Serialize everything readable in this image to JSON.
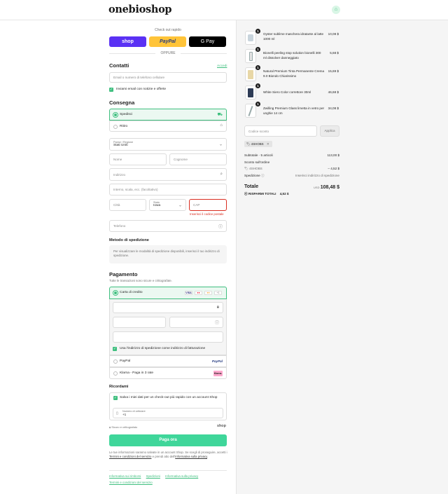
{
  "header": {
    "logo": "onebioshop",
    "cart_icon": "shopping-bag-icon"
  },
  "express": {
    "title": "Check out rapido",
    "shop_label": "shop",
    "paypal_label": "PayPal",
    "gpay_label": "G Pay",
    "or_label": "OPPURE",
    "colors": {
      "shop": "#5a31f4",
      "paypal": "#ffc439",
      "gpay": "#000000"
    }
  },
  "contact": {
    "title": "Contatti",
    "login_link": "Accedi",
    "email_placeholder": "Email o numero di telefono cellulare",
    "newsletter_label": "Inviami email con notizie e offerte"
  },
  "delivery": {
    "title": "Consegna",
    "options": [
      {
        "label": "Spedisci",
        "selected": true,
        "icon": "truck-icon"
      },
      {
        "label": "Ritiro",
        "selected": false,
        "icon": "store-icon"
      }
    ],
    "country_label": "Paese / Regione",
    "country_value": "Stati Uniti",
    "first_name_placeholder": "Nome",
    "last_name_placeholder": "Cognome",
    "address_placeholder": "Indirizzo",
    "apt_placeholder": "Interno, scala, ecc. (facoltativo)",
    "city_placeholder": "Città",
    "state_label": "Stato",
    "state_value": "Iowa",
    "zip_placeholder": "CAP",
    "zip_error": "Inserisci il codice postale",
    "phone_placeholder": "Telefono"
  },
  "shipping_method": {
    "title": "Metodo di spedizione",
    "info": "Per visualizzare le modalità di spedizione disponibili, inserisci il tuo indirizzo di spedizione."
  },
  "payment": {
    "title": "Pagamento",
    "subtitle": "Tutte le transazioni sono sicure e crittografate.",
    "card_label": "Carta di credito",
    "card_brands": [
      "VISA",
      "Maestro",
      "Mastercard",
      "+1"
    ],
    "billing_same_label": "Usa l'indirizzo di spedizione come indirizzo di fatturazione",
    "paypal_label": "PayPal",
    "paypal_logo": "PayPal",
    "klarna_label": "Klarna - Paga in 3 rate",
    "klarna_logo": "Klarna."
  },
  "remember": {
    "title": "Ricordami",
    "save_label": "Salva i miei dati per un check-out più rapido con un account Shop",
    "mobile_label": "Numero di cellulare",
    "mobile_prefix": "+1",
    "secure_label": "Sicuro e crittografato",
    "shop_label": "shop"
  },
  "pay_button": "Paga ora",
  "legal_text_1": "Le tue informazioni saranno salvate in un account Shop. Se scegli di proseguire, accetti i ",
  "legal_terms": "Termini e condizioni del servizio",
  "legal_text_2": " e prendi atto dell'",
  "legal_privacy": "Informativa sulla privacy",
  "footer_links": [
    "Informativa sui rimborsi",
    "Spedizioni",
    "Informativa sulla privacy",
    "Termini e condizioni del servizio"
  ],
  "cart": {
    "items": [
      {
        "qty": "1",
        "name": "Oyster sublime maschera idratante al latte 1000 ml",
        "price": "10,08 $"
      },
      {
        "qty": "1",
        "name": "Bionelli peeling stop solution bionelli 300 ml dissolver danneggiato",
        "price": "5,68 $"
      },
      {
        "qty": "1",
        "name": "Natural Premium Tinta Permanente Crema 9.0 Biondo Chiarissimo",
        "price": "15,69 $"
      },
      {
        "qty": "1",
        "name": "White Siero Color correttore 30ml",
        "price": "46,68 $"
      },
      {
        "qty": "1",
        "name": "Zwilling Premium Glass limetta in vetro per unghie 14 cm",
        "price": "34,08 $"
      }
    ],
    "discount_placeholder": "Codice sconto",
    "apply_label": "Applica",
    "coupon": "4SHOBS",
    "subtotal_label": "Subtotale · 5 articoli",
    "subtotal_value": "113,00 $",
    "order_discount_label": "Sconto sull'ordine",
    "coupon_code": "4SHOBS",
    "discount_value": "– 4,52 $",
    "shipping_label": "Spedizione",
    "shipping_value": "Inserisci indirizzo di spedizione",
    "total_label": "Totale",
    "currency": "USD",
    "total_value": "108,48 $",
    "savings_label": "RISPARMI TOTALI",
    "savings_value": "4,52 $"
  }
}
